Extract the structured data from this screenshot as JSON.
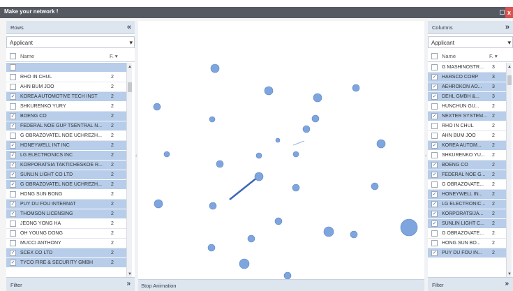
{
  "window": {
    "faint_text": "",
    "title": "Make your network !",
    "close_glyph": "x",
    "restore_icon": "restore-icon"
  },
  "left_panel": {
    "header": "Rows",
    "collapse_glyph": "«",
    "selector_value": "Applicant",
    "dropdown_glyph": "▾",
    "col_name": "Name",
    "col_f": "F. ▾",
    "rows": [
      {
        "name": "",
        "count": "",
        "selected": true
      },
      {
        "name": "RHO IN CHUL",
        "count": "2",
        "selected": false
      },
      {
        "name": "AHN BUM JOO",
        "count": "2",
        "selected": false
      },
      {
        "name": "KOREA AUTOMOTIVE TECH INST",
        "count": "2",
        "selected": true
      },
      {
        "name": "SHKURENKO YURY",
        "count": "2",
        "selected": false
      },
      {
        "name": "BOENG CO",
        "count": "2",
        "selected": true
      },
      {
        "name": "FEDERAL NOE GUP TSENTRAL N...",
        "count": "2",
        "selected": true
      },
      {
        "name": "G OBRAZOVATEL NOE UCHREZH...",
        "count": "2",
        "selected": false
      },
      {
        "name": "HONEYWELL INT INC",
        "count": "2",
        "selected": true
      },
      {
        "name": "LG ELECTRONICS INC",
        "count": "2",
        "selected": true
      },
      {
        "name": "KORPORATSIA TAKTICHESKOE R...",
        "count": "2",
        "selected": true
      },
      {
        "name": "SUNLIN LIGHT CO LTD",
        "count": "2",
        "selected": true
      },
      {
        "name": "G OBRAZOVATEL NOE UCHREZH...",
        "count": "2",
        "selected": true
      },
      {
        "name": "HONG SUN BONG",
        "count": "2",
        "selected": false
      },
      {
        "name": "PUY DU FOU INTERNAT",
        "count": "2",
        "selected": true
      },
      {
        "name": "THOMSON LICENSING",
        "count": "2",
        "selected": true
      },
      {
        "name": "JEONG YONG HA",
        "count": "2",
        "selected": false
      },
      {
        "name": "OH YOUNG DONG",
        "count": "2",
        "selected": false
      },
      {
        "name": "MUCCI ANTHONY",
        "count": "2",
        "selected": false
      },
      {
        "name": "SCEX CO LTD",
        "count": "2",
        "selected": true
      },
      {
        "name": "TYCO FIRE & SECURITY GMBH",
        "count": "2",
        "selected": true
      }
    ],
    "footer": "Filter",
    "footer_glyph": "»"
  },
  "right_panel": {
    "header": "Columns",
    "collapse_glyph": "»",
    "selector_value": "Applicant",
    "dropdown_glyph": "▾",
    "col_name": "Name",
    "col_f": "F. ▾",
    "rows": [
      {
        "name": "G MASHINOSTR...",
        "count": "3",
        "selected": false
      },
      {
        "name": "HARSCO CORP",
        "count": "3",
        "selected": true
      },
      {
        "name": "AEHROKON AO...",
        "count": "3",
        "selected": true
      },
      {
        "name": "DEHL GMBH &...",
        "count": "3",
        "selected": true
      },
      {
        "name": "HUNCHUN GU...",
        "count": "2",
        "selected": false
      },
      {
        "name": "NEXTER SYSTEM...",
        "count": "2",
        "selected": true
      },
      {
        "name": "RHO IN CHUL",
        "count": "2",
        "selected": false
      },
      {
        "name": "AHN BUM JOO",
        "count": "2",
        "selected": false
      },
      {
        "name": "KOREA AUTOM...",
        "count": "2",
        "selected": true
      },
      {
        "name": "SHKURENKO YU...",
        "count": "2",
        "selected": false
      },
      {
        "name": "BOENG CO",
        "count": "2",
        "selected": true
      },
      {
        "name": "FEDERAL NOE G...",
        "count": "2",
        "selected": true
      },
      {
        "name": "G OBRAZOVATE...",
        "count": "2",
        "selected": false
      },
      {
        "name": "HONEYWELL IN...",
        "count": "2",
        "selected": true
      },
      {
        "name": "LG ELECTRONIC...",
        "count": "2",
        "selected": true
      },
      {
        "name": "KORPORATSIJA...",
        "count": "2",
        "selected": true
      },
      {
        "name": "SUNLIN LIGHT C...",
        "count": "2",
        "selected": true
      },
      {
        "name": "G OBRAZOVATE...",
        "count": "2",
        "selected": false
      },
      {
        "name": "HONG SUN BO...",
        "count": "2",
        "selected": false
      },
      {
        "name": "PUY DU FOU IN...",
        "count": "2",
        "selected": true
      }
    ],
    "footer": "Filter",
    "footer_glyph": "»"
  },
  "splitter_grip": "‹",
  "network": {
    "stop_label": "Stop Animation",
    "node_color": "#7fa5de",
    "edge_color": "#3d67b4"
  },
  "colors": {
    "title_bar": "#555a62",
    "close_button": "#d9534f",
    "selected_row": "#b7cde9",
    "panel_header": "#dde5ef"
  }
}
